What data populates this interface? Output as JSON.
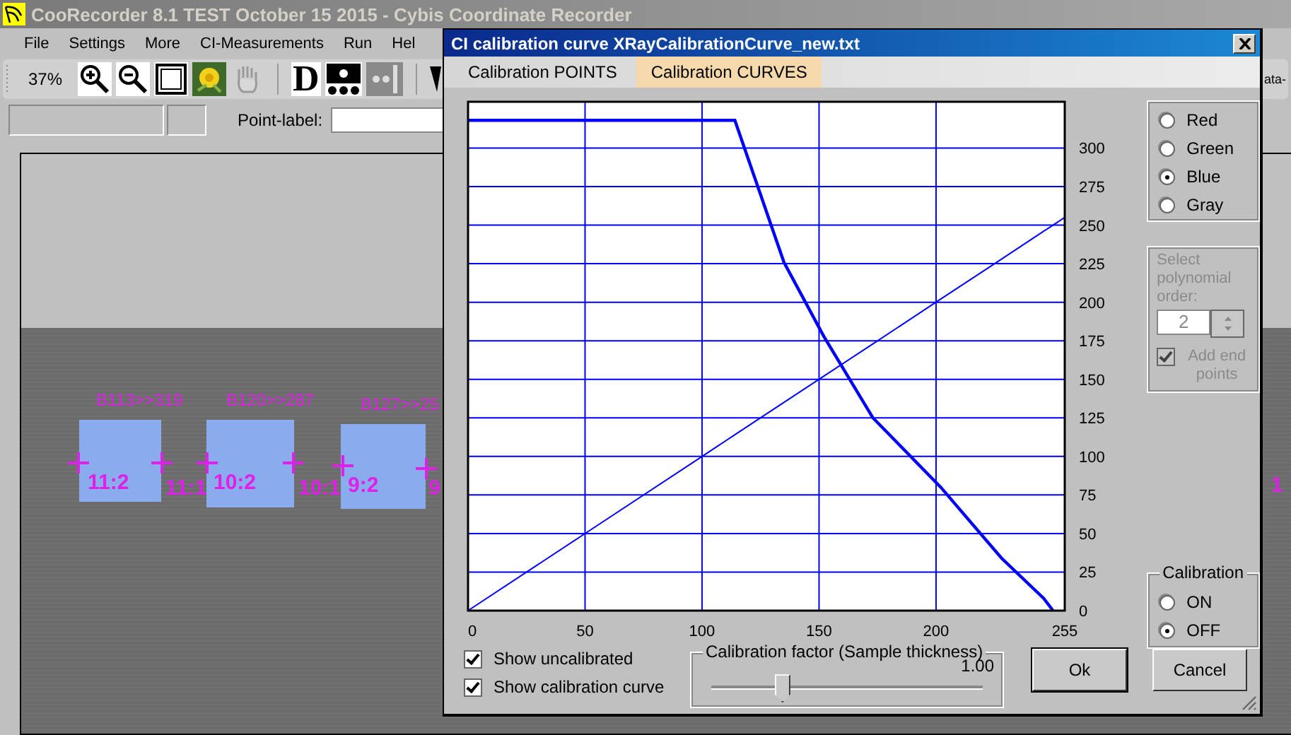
{
  "app": {
    "title": "CooRecorder 8.1 TEST October 15 2015 - Cybis Coordinate Recorder",
    "menu": [
      "File",
      "Settings",
      "More",
      "CI-Measurements",
      "Run",
      "Hel"
    ],
    "zoom": "37%",
    "letter_tool": "D",
    "point_label": "Point-label:",
    "right_edge_text": "ata-",
    "measure_labels": [
      "B113>>319",
      "B120>>287",
      "B127>>25"
    ],
    "point_labels": [
      "11:2",
      "11:1",
      "10:2",
      "10:1",
      "9:2",
      "9",
      "1"
    ]
  },
  "dialog": {
    "title": "CI calibration curve XRayCalibrationCurve_new.txt",
    "tabs": [
      {
        "label": "Calibration POINTS",
        "selected": false
      },
      {
        "label": "Calibration CURVES",
        "selected": true
      }
    ],
    "chart_data": {
      "type": "line",
      "grid": true,
      "x": [
        0,
        50,
        100,
        114,
        135,
        152,
        173,
        202,
        228,
        246,
        250,
        255
      ],
      "xlim": [
        0,
        255
      ],
      "ylim": [
        0,
        330
      ],
      "xticks": [
        0,
        50,
        100,
        150,
        200,
        255
      ],
      "yticks": [
        0,
        25,
        50,
        75,
        100,
        125,
        150,
        175,
        200,
        225,
        250,
        275,
        300
      ],
      "series": [
        {
          "color": "#0000ff",
          "values": [
            318,
            318,
            318,
            318,
            226,
            178,
            125,
            80,
            34,
            8,
            0,
            null
          ]
        },
        {
          "color": "#0000ff",
          "values": [
            0,
            50,
            100,
            114,
            135,
            152,
            173,
            202,
            228,
            246,
            250,
            255
          ]
        }
      ]
    },
    "color_options": [
      {
        "label": "Red",
        "selected": false
      },
      {
        "label": "Green",
        "selected": false
      },
      {
        "label": "Blue",
        "selected": true
      },
      {
        "label": "Gray",
        "selected": false
      }
    ],
    "polynomial": {
      "label": "Select polynomial order:",
      "value": "2",
      "disabled": true,
      "add_end_points": {
        "label": "Add end points",
        "checked": true
      }
    },
    "calibration": {
      "title": "Calibration",
      "options": [
        {
          "label": "ON",
          "selected": false
        },
        {
          "label": "OFF",
          "selected": true
        }
      ]
    },
    "checkboxes": [
      {
        "label": "Show uncalibrated",
        "checked": true
      },
      {
        "label": "Show calibration curve",
        "checked": true
      }
    ],
    "calibration_factor": {
      "title": "Calibration factor (Sample thickness)",
      "reading": "1.00",
      "level": 0.26
    },
    "buttons": [
      "Ok",
      "Cancel"
    ]
  }
}
